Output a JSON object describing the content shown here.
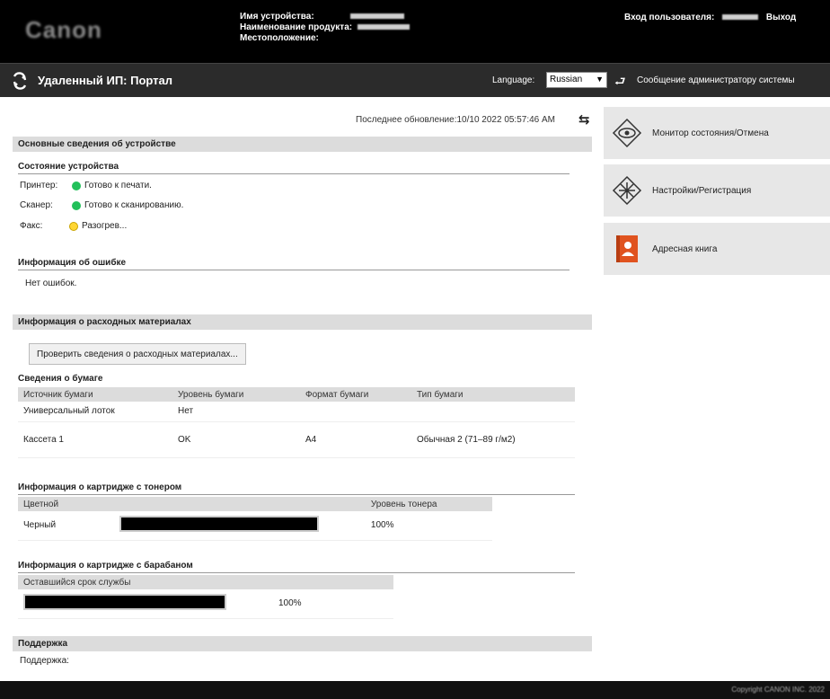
{
  "header": {
    "logo_text": "Canon",
    "device_name_label": "Имя устройства:",
    "product_name_label": "Наименование продукта:",
    "location_label": "Местоположение:",
    "user_label": "Вход пользователя:",
    "logout_label": "Выход"
  },
  "titlebar": {
    "app_title": "Удаленный ИП: Портал",
    "language_label": "Language:",
    "language_value": "Russian",
    "admin_message": "Сообщение администратору системы"
  },
  "main": {
    "last_updated": "Последнее обновление:10/10 2022 05:57:46 AM",
    "basic_info_title": "Основные сведения об устройстве",
    "device_status_title": "Состояние устройства",
    "status_rows": [
      {
        "label": "Принтер:",
        "status": "Готово к печати.",
        "color": "#22c05a"
      },
      {
        "label": "Сканер:",
        "status": "Готово к сканированию.",
        "color": "#22c05a"
      },
      {
        "label": "Факс:",
        "status": "Разогрев...",
        "color": "#ffd633"
      }
    ],
    "error_info_title": "Информация об ошибке",
    "error_info_value": "Нет ошибок.",
    "consumables_title": "Информация о расходных материалах",
    "check_consumables_button": "Проверить сведения о расходных материалах...",
    "paper_info_title": "Сведения о бумаге",
    "paper_table": {
      "headers": [
        "Источник бумаги",
        "Уровень бумаги",
        "Формат бумаги",
        "Тип бумаги"
      ],
      "rows": [
        [
          "Универсальный лоток",
          "Нет",
          "",
          ""
        ],
        [
          "Кассета 1",
          "OK",
          "A4",
          "Обычная 2 (71–89 г/м2)"
        ]
      ]
    },
    "toner_title": "Информация о картридже с тонером",
    "toner_table": {
      "headers": [
        "Цветной",
        "",
        "Уровень тонера"
      ],
      "rows": [
        {
          "color": "Черный",
          "level": "100%",
          "level_fraction": 1.0
        }
      ]
    },
    "drum_title": "Информация о картридже с барабаном",
    "drum_table": {
      "headers": [
        "Оставшийся срок службы",
        ""
      ],
      "level": "100%",
      "level_fraction": 1.0
    },
    "support_title": "Поддержка",
    "support_label": "Поддержка:"
  },
  "sidebar": {
    "items": [
      {
        "label": "Монитор состояния/Отмена",
        "icon": "eye-icon"
      },
      {
        "label": "Настройки/Регистрация",
        "icon": "settings-icon"
      },
      {
        "label": "Адресная книга",
        "icon": "address-book-icon"
      }
    ]
  },
  "footer": {
    "copyright": "Copyright CANON INC. 2022"
  }
}
